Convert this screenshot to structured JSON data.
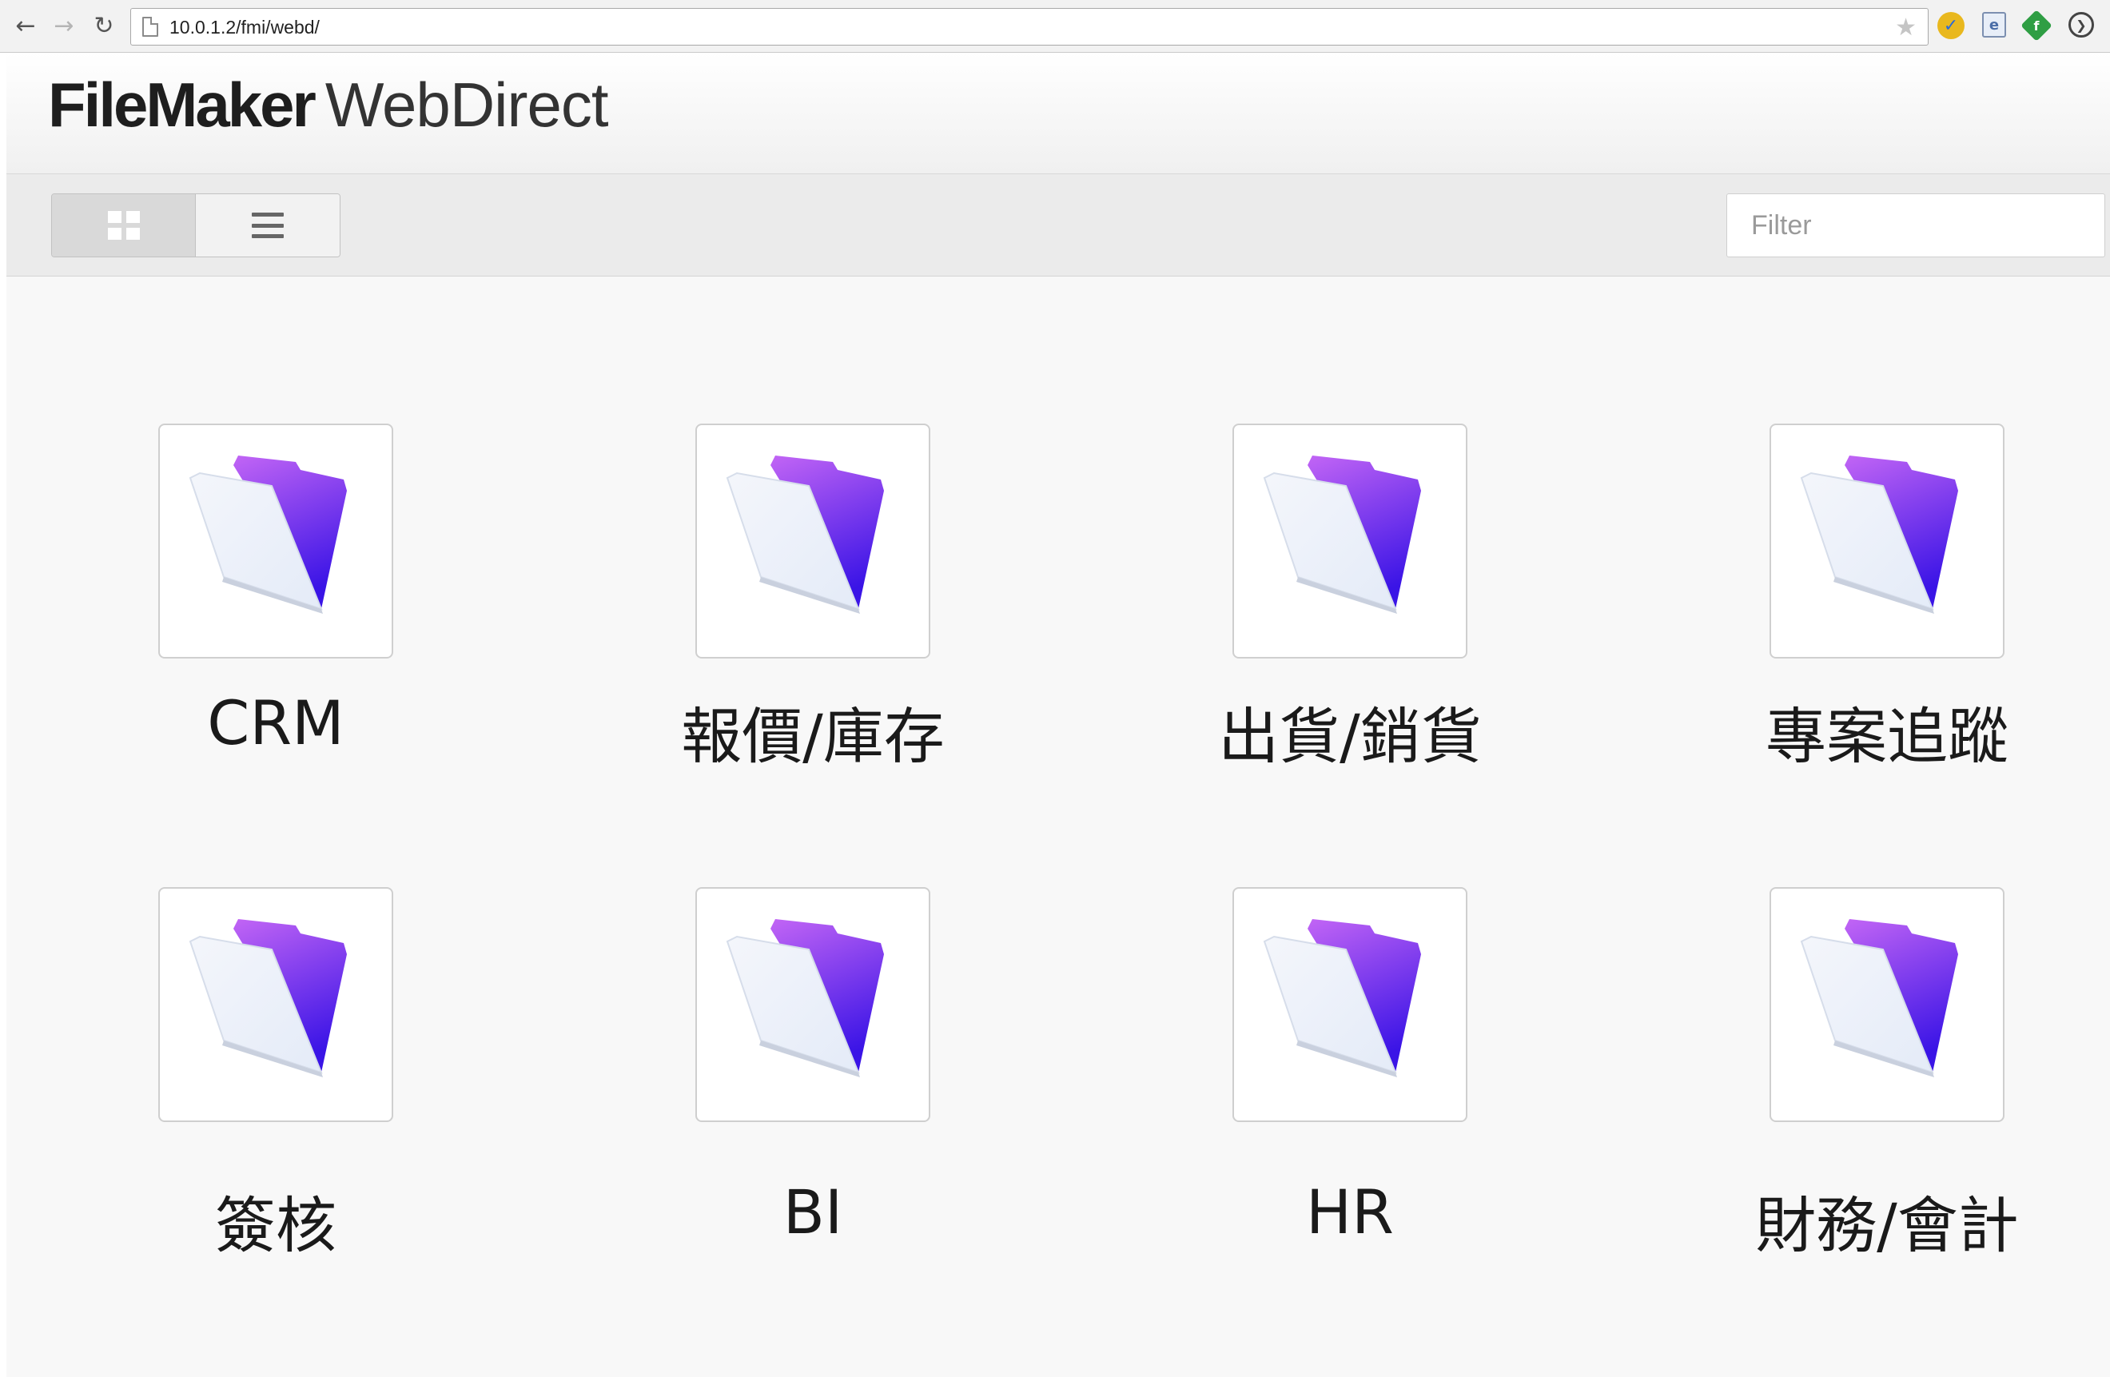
{
  "browser": {
    "url": "10.0.1.2/fmi/webd/",
    "back_glyph": "←",
    "forward_glyph": "→",
    "reload_glyph": "↻",
    "star_glyph": "★",
    "extensions": [
      "norton-icon",
      "evernote-icon",
      "feedly-icon",
      "pocket-icon"
    ]
  },
  "header": {
    "brand_bold": "FileMaker",
    "brand_light": "WebDirect"
  },
  "toolbar": {
    "view_modes": [
      "grid",
      "list"
    ],
    "active_view": "grid",
    "filter_placeholder": "Filter"
  },
  "files": [
    {
      "label": "CRM"
    },
    {
      "label": "報價/庫存"
    },
    {
      "label": "出貨/銷貨"
    },
    {
      "label": "專案追蹤"
    },
    {
      "label": "簽核"
    },
    {
      "label": "BI"
    },
    {
      "label": "HR"
    },
    {
      "label": "財務/會計"
    }
  ],
  "colors": {
    "folder_accent_top": "#c265f5",
    "folder_accent_bottom": "#3a14e6",
    "folder_front": "#e4ebf8"
  }
}
